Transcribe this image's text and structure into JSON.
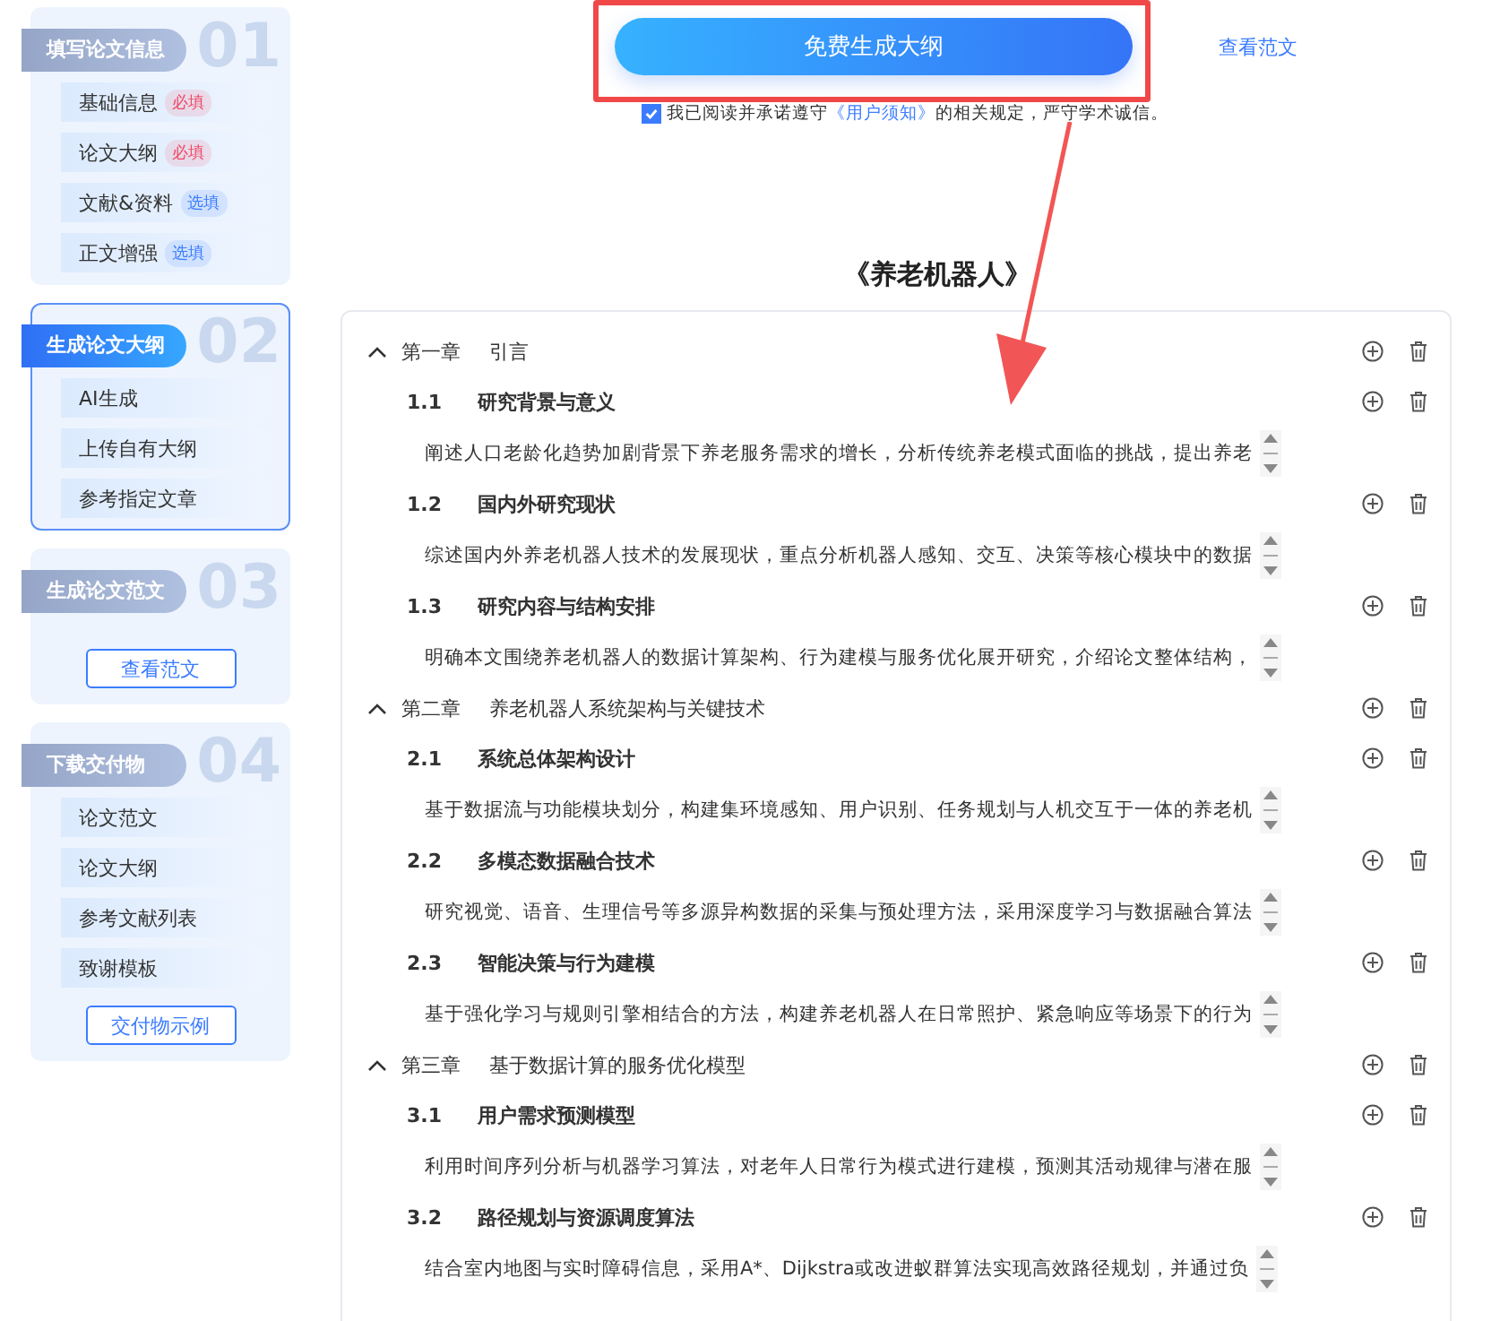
{
  "steps": [
    {
      "number": "01",
      "title": "填写论文信息",
      "selected": false,
      "items": [
        {
          "label": "基础信息",
          "tag": {
            "text": "必填",
            "color": "#f04864"
          }
        },
        {
          "label": "论文大纲",
          "tag": {
            "text": "必填",
            "color": "#f04864"
          }
        },
        {
          "label": "文献&资料",
          "tag": {
            "text": "选填",
            "color": "#3b7cff"
          }
        },
        {
          "label": "正文增强",
          "tag": {
            "text": "选填",
            "color": "#3b7cff"
          }
        }
      ]
    },
    {
      "number": "02",
      "title": "生成论文大纲",
      "selected": true,
      "items": [
        {
          "label": "AI生成"
        },
        {
          "label": "上传自有大纲"
        },
        {
          "label": "参考指定文章"
        }
      ]
    },
    {
      "number": "03",
      "title": "生成论文范文",
      "selected": false,
      "button": "查看范文"
    },
    {
      "number": "04",
      "title": "下载交付物",
      "selected": false,
      "items": [
        {
          "label": "论文范文"
        },
        {
          "label": "论文大纲"
        },
        {
          "label": "参考文献列表"
        },
        {
          "label": "致谢模板"
        }
      ],
      "button": "交付物示例"
    }
  ],
  "generate_button": "免费生成大纲",
  "view_sample_link": "查看范文",
  "agreement": {
    "checked": true,
    "before": "我已阅读并承诺遵守",
    "link": "《用户须知》",
    "after": "的相关规定，严守学术诚信。"
  },
  "outline_title": "《养老机器人》",
  "chapters": [
    {
      "label": "第一章",
      "title": "引言",
      "expanded": true,
      "sections": [
        {
          "number": "1.1",
          "title": "研究背景与意义",
          "description": "阐述人口老龄化趋势加剧背景下养老服务需求的增长，分析传统养老模式面临的挑战，提出养老"
        },
        {
          "number": "1.2",
          "title": "国内外研究现状",
          "description": "综述国内外养老机器人技术的发展现状，重点分析机器人感知、交互、决策等核心模块中的数据"
        },
        {
          "number": "1.3",
          "title": "研究内容与结构安排",
          "description": "明确本文围绕养老机器人的数据计算架构、行为建模与服务优化展开研究，介绍论文整体结构，"
        }
      ]
    },
    {
      "label": "第二章",
      "title": "养老机器人系统架构与关键技术",
      "expanded": true,
      "sections": [
        {
          "number": "2.1",
          "title": "系统总体架构设计",
          "description": "基于数据流与功能模块划分，构建集环境感知、用户识别、任务规划与人机交互于一体的养老机"
        },
        {
          "number": "2.2",
          "title": "多模态数据融合技术",
          "description": "研究视觉、语音、生理信号等多源异构数据的采集与预处理方法，采用深度学习与数据融合算法"
        },
        {
          "number": "2.3",
          "title": "智能决策与行为建模",
          "description": "基于强化学习与规则引擎相结合的方法，构建养老机器人在日常照护、紧急响应等场景下的行为"
        }
      ]
    },
    {
      "label": "第三章",
      "title": "基于数据计算的服务优化模型",
      "expanded": true,
      "sections": [
        {
          "number": "3.1",
          "title": "用户需求预测模型",
          "description": "利用时间序列分析与机器学习算法，对老年人日常行为模式进行建模，预测其活动规律与潜在服"
        },
        {
          "number": "3.2",
          "title": "路径规划与资源调度算法",
          "description": "结合室内地图与实时障碍信息，采用A*、Dijkstra或改进蚁群算法实现高效路径规划，并通过负"
        }
      ]
    }
  ]
}
